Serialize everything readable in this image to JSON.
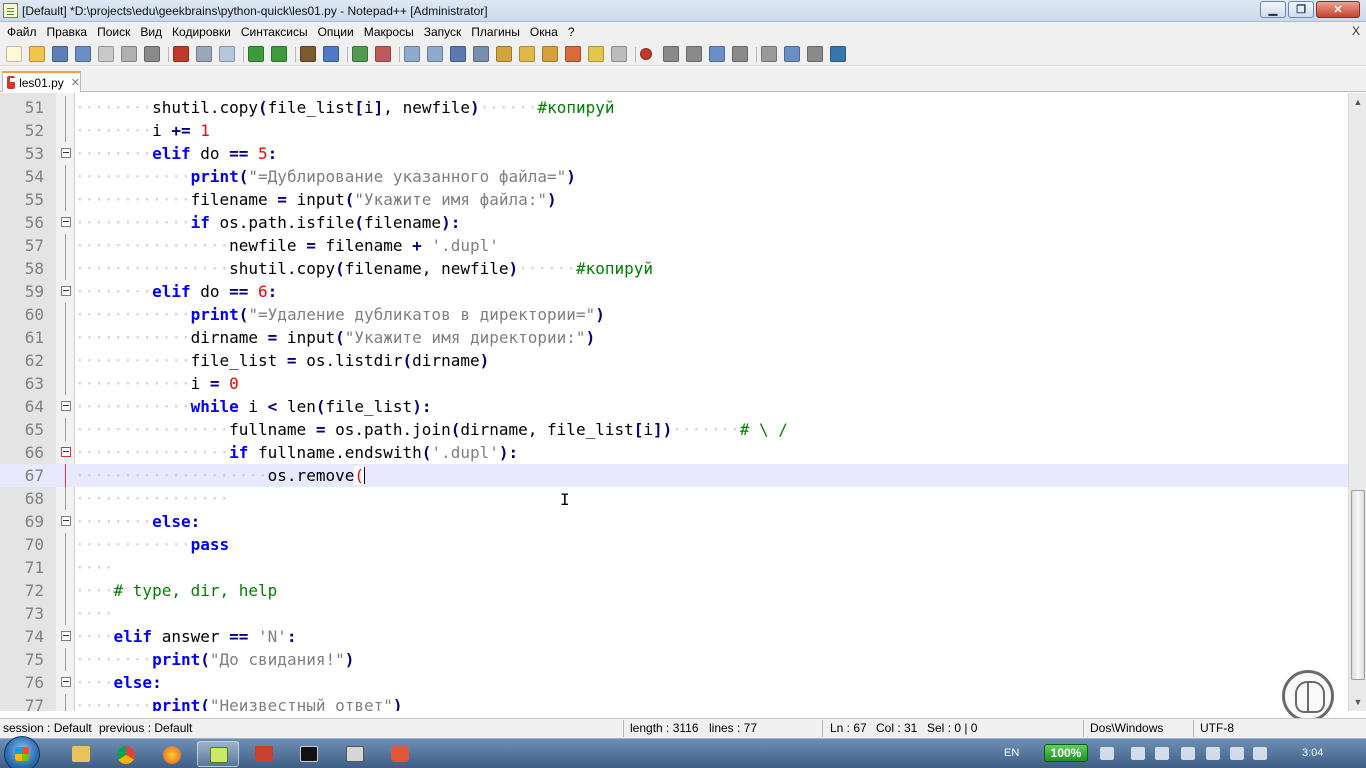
{
  "window": {
    "title": "[Default] *D:\\projects\\edu\\geekbrains\\python-quick\\les01.py - Notepad++ [Administrator]",
    "min_label": "▁",
    "max_label": "❐",
    "close_label": "✕"
  },
  "menu": {
    "items": [
      "Файл",
      "Правка",
      "Поиск",
      "Вид",
      "Кодировки",
      "Синтаксисы",
      "Опции",
      "Макросы",
      "Запуск",
      "Плагины",
      "Окна",
      "?"
    ],
    "close": "X"
  },
  "toolbar": {
    "icons": [
      "new-file-icon",
      "open-file-icon",
      "save-icon",
      "save-all-icon",
      "close-icon",
      "close-all-icon",
      "print-icon",
      "cut-icon",
      "copy-icon",
      "paste-icon",
      "undo-icon",
      "redo-icon",
      "find-icon",
      "replace-icon",
      "zoom-in-icon",
      "zoom-out-icon",
      "sync-v-icon",
      "sync-h-icon",
      "wrap-icon",
      "all-chars-icon",
      "indent-guide-icon",
      "udl-icon",
      "doc-map-icon",
      "function-list-icon",
      "folder-workspace-icon",
      "monitoring-icon",
      "record-macro-icon",
      "stop-macro-icon",
      "play-macro-icon",
      "run-multi-macro-icon",
      "save-macro-icon",
      "plugin-1-icon",
      "plugin-2-icon",
      "plugin-3-icon",
      "python-icon"
    ]
  },
  "tab": {
    "label": "les01.py",
    "close": "✕"
  },
  "editor": {
    "lines": [
      {
        "n": "51",
        "tokens": [
          [
            "ws",
            "········"
          ],
          [
            "",
            "shutil"
          ],
          [
            "",
            "."
          ],
          [
            "",
            "copy"
          ],
          [
            "paren",
            "("
          ],
          [
            "",
            "file_list"
          ],
          [
            "paren",
            "["
          ],
          [
            "",
            "i"
          ],
          [
            "paren",
            "]"
          ],
          [
            "",
            ", newfile"
          ],
          [
            "paren",
            ")"
          ],
          [
            "ws",
            "······"
          ],
          [
            "cmt",
            "#копируй"
          ]
        ],
        "fold": "line"
      },
      {
        "n": "52",
        "tokens": [
          [
            "ws",
            "········"
          ],
          [
            "",
            "i "
          ],
          [
            "op",
            "+="
          ],
          [
            "",
            ""
          ],
          [
            "num",
            " 1"
          ]
        ],
        "fold": "line"
      },
      {
        "n": "53",
        "tokens": [
          [
            "ws",
            "········"
          ],
          [
            "kw",
            "elif"
          ],
          [
            "",
            " do "
          ],
          [
            "op",
            "=="
          ],
          [
            "num",
            " 5"
          ],
          [
            "op",
            ":"
          ]
        ],
        "fold": "box"
      },
      {
        "n": "54",
        "tokens": [
          [
            "ws",
            "············"
          ],
          [
            "kw",
            "print"
          ],
          [
            "paren",
            "("
          ],
          [
            "str",
            "\"=Дублирование указанного файла=\""
          ],
          [
            "paren",
            ")"
          ]
        ],
        "fold": "line"
      },
      {
        "n": "55",
        "tokens": [
          [
            "ws",
            "············"
          ],
          [
            "",
            "filename "
          ],
          [
            "op",
            "="
          ],
          [
            "",
            " input"
          ],
          [
            "paren",
            "("
          ],
          [
            "str",
            "\"Укажите имя файла:\""
          ],
          [
            "paren",
            ")"
          ]
        ],
        "fold": "line"
      },
      {
        "n": "56",
        "tokens": [
          [
            "ws",
            "············"
          ],
          [
            "kw",
            "if"
          ],
          [
            "",
            " os.path.isfile"
          ],
          [
            "paren",
            "("
          ],
          [
            "",
            "filename"
          ],
          [
            "paren",
            ")"
          ],
          [
            "op",
            ":"
          ]
        ],
        "fold": "box"
      },
      {
        "n": "57",
        "tokens": [
          [
            "ws",
            "················"
          ],
          [
            "",
            "newfile "
          ],
          [
            "op",
            "="
          ],
          [
            "",
            " filename "
          ],
          [
            "op",
            "+"
          ],
          [
            "str",
            " '.dupl'"
          ]
        ],
        "fold": "line"
      },
      {
        "n": "58",
        "tokens": [
          [
            "ws",
            "················"
          ],
          [
            "",
            "shutil.copy"
          ],
          [
            "paren",
            "("
          ],
          [
            "",
            "filename, newfile"
          ],
          [
            "paren",
            ")"
          ],
          [
            "ws",
            "······"
          ],
          [
            "cmt",
            "#копируй"
          ]
        ],
        "fold": "line"
      },
      {
        "n": "59",
        "tokens": [
          [
            "ws",
            "········"
          ],
          [
            "kw",
            "elif"
          ],
          [
            "",
            " do "
          ],
          [
            "op",
            "=="
          ],
          [
            "num",
            " 6"
          ],
          [
            "op",
            ":"
          ]
        ],
        "fold": "box"
      },
      {
        "n": "60",
        "tokens": [
          [
            "ws",
            "············"
          ],
          [
            "kw",
            "print"
          ],
          [
            "paren",
            "("
          ],
          [
            "str",
            "\"=Удаление дубликатов в директории=\""
          ],
          [
            "paren",
            ")"
          ]
        ],
        "fold": "line"
      },
      {
        "n": "61",
        "tokens": [
          [
            "ws",
            "············"
          ],
          [
            "",
            "dirname "
          ],
          [
            "op",
            "="
          ],
          [
            "",
            " input"
          ],
          [
            "paren",
            "("
          ],
          [
            "str",
            "\"Укажите имя директории:\""
          ],
          [
            "paren",
            ")"
          ]
        ],
        "fold": "line"
      },
      {
        "n": "62",
        "tokens": [
          [
            "ws",
            "············"
          ],
          [
            "",
            "file_list "
          ],
          [
            "op",
            "="
          ],
          [
            "",
            " os.listdir"
          ],
          [
            "paren",
            "("
          ],
          [
            "",
            "dirname"
          ],
          [
            "paren",
            ")"
          ]
        ],
        "fold": "line"
      },
      {
        "n": "63",
        "tokens": [
          [
            "ws",
            "············"
          ],
          [
            "",
            "i "
          ],
          [
            "op",
            "="
          ],
          [
            "num",
            " 0"
          ]
        ],
        "fold": "line"
      },
      {
        "n": "64",
        "tokens": [
          [
            "ws",
            "············"
          ],
          [
            "kw",
            "while"
          ],
          [
            "",
            " i "
          ],
          [
            "op",
            "<"
          ],
          [
            "",
            " len"
          ],
          [
            "paren",
            "("
          ],
          [
            "",
            "file_list"
          ],
          [
            "paren",
            ")"
          ],
          [
            "op",
            ":"
          ]
        ],
        "fold": "box"
      },
      {
        "n": "65",
        "tokens": [
          [
            "ws",
            "················"
          ],
          [
            "",
            "fullname "
          ],
          [
            "op",
            "="
          ],
          [
            "",
            " os.path.join"
          ],
          [
            "paren",
            "("
          ],
          [
            "",
            "dirname, file_list"
          ],
          [
            "paren",
            "["
          ],
          [
            "",
            "i"
          ],
          [
            "paren",
            "])"
          ],
          [
            "ws",
            "·······"
          ],
          [
            "cmt",
            "# \\ /"
          ]
        ],
        "fold": "line"
      },
      {
        "n": "66",
        "tokens": [
          [
            "ws",
            "················"
          ],
          [
            "kw",
            "if"
          ],
          [
            "",
            " fullname.endswith"
          ],
          [
            "paren",
            "("
          ],
          [
            "str",
            "'.dupl'"
          ],
          [
            "paren",
            ")"
          ],
          [
            "op",
            ":"
          ]
        ],
        "fold": "box-red"
      },
      {
        "n": "67",
        "tokens": [
          [
            "ws",
            "····················"
          ],
          [
            "",
            "os.remove"
          ],
          [
            "caret-paren",
            "("
          ]
        ],
        "fold": "line-red",
        "current": true
      },
      {
        "n": "68",
        "tokens": [
          [
            "ws",
            "················"
          ]
        ],
        "fold": "line"
      },
      {
        "n": "69",
        "tokens": [
          [
            "ws",
            "········"
          ],
          [
            "kw",
            "else"
          ],
          [
            "op",
            ":"
          ]
        ],
        "fold": "box"
      },
      {
        "n": "70",
        "tokens": [
          [
            "ws",
            "············"
          ],
          [
            "kw",
            "pass"
          ]
        ],
        "fold": "line"
      },
      {
        "n": "71",
        "tokens": [
          [
            "ws",
            "····"
          ]
        ],
        "fold": "line"
      },
      {
        "n": "72",
        "tokens": [
          [
            "ws",
            "····"
          ],
          [
            "cmt",
            "# type, dir, help"
          ]
        ],
        "fold": "line"
      },
      {
        "n": "73",
        "tokens": [
          [
            "ws",
            "····"
          ]
        ],
        "fold": "line"
      },
      {
        "n": "74",
        "tokens": [
          [
            "ws",
            "····"
          ],
          [
            "kw",
            "elif"
          ],
          [
            "",
            " answer "
          ],
          [
            "op",
            "=="
          ],
          [
            "str",
            " 'N'"
          ],
          [
            "op",
            ":"
          ]
        ],
        "fold": "box"
      },
      {
        "n": "75",
        "tokens": [
          [
            "ws",
            "········"
          ],
          [
            "kw",
            "print"
          ],
          [
            "paren",
            "("
          ],
          [
            "str",
            "\"До свидания!\""
          ],
          [
            "paren",
            ")"
          ]
        ],
        "fold": "line"
      },
      {
        "n": "76",
        "tokens": [
          [
            "ws",
            "····"
          ],
          [
            "kw",
            "else"
          ],
          [
            "op",
            ":"
          ]
        ],
        "fold": "box"
      },
      {
        "n": "77",
        "tokens": [
          [
            "ws",
            "········"
          ],
          [
            "kw",
            "print"
          ],
          [
            "paren",
            "("
          ],
          [
            "str",
            "\"Неизвестный ответ\""
          ],
          [
            "paren",
            ")"
          ]
        ],
        "fold": "line"
      }
    ]
  },
  "statusbar": {
    "session": "session : Default",
    "previous": "previous : Default",
    "length": "length : 3116",
    "lines": "lines : 77",
    "ln": "Ln : 67",
    "col": "Col : 31",
    "sel": "Sel : 0 | 0",
    "eol": "Dos\\Windows",
    "encoding": "UTF-8"
  },
  "taskbar": {
    "apps": [
      "explorer-icon",
      "chrome-icon",
      "firefox-icon",
      "notepadpp-icon",
      "app-red-icon",
      "cmd-icon",
      "app-window-icon",
      "app-orange-icon"
    ],
    "lang": "EN",
    "battery": "100%",
    "clock": "3:04"
  },
  "colors": {
    "keyword": "#0000ff",
    "string": "#808080",
    "number": "#ff0000",
    "comment": "#008000",
    "operator": "#000080",
    "current_line": "#e8e8ff"
  }
}
